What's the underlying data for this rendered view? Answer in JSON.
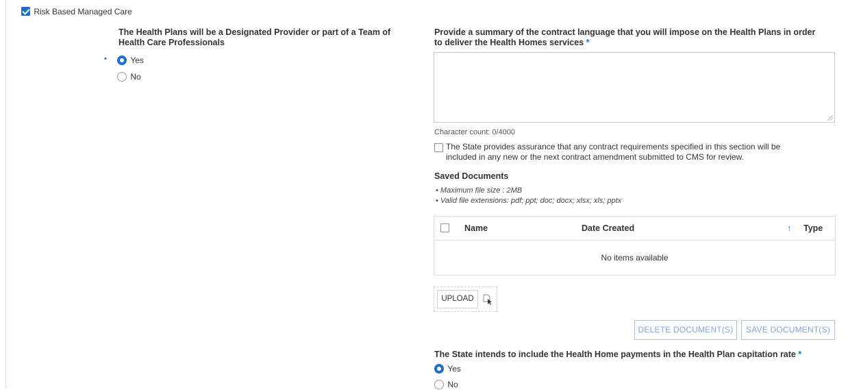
{
  "risk_checkbox": {
    "label": "Risk Based Managed Care",
    "checked": true
  },
  "left_question": {
    "label_line1": "The Health Plans will be a Designated Provider or part of a Team of",
    "label_line2": "Health Care Professionals",
    "required_marker": "•",
    "options": [
      {
        "label": "Yes",
        "selected": true
      },
      {
        "label": "No",
        "selected": false
      }
    ]
  },
  "summary": {
    "label_line1": "Provide a summary of the contract language that you will impose on the Health Plans in order",
    "label_line2": "to deliver the Health Homes services",
    "required_marker": "*",
    "value": "",
    "character_count": "Character count: 0/4000"
  },
  "assurance": {
    "line1": "The State provides assurance that any contract requirements specified in this section will be",
    "line2": "included in any new or the next contract amendment submitted to CMS for review.",
    "checked": false
  },
  "saved_documents": {
    "title": "Saved Documents",
    "notes": [
      "Maximum file size : 2MB",
      "Valid file extensions: pdf; ppt; doc; docx; xlsx; xls; pptx"
    ],
    "columns": {
      "name": "Name",
      "date_created": "Date Created",
      "type": "Type",
      "sort_indicator": "↑"
    },
    "empty_text": "No items available",
    "upload_label": "UPLOAD",
    "delete_label": "DELETE DOCUMENT(S)",
    "save_label": "SAVE DOCUMENT(S)"
  },
  "capitation_question": {
    "label": "The State intends to include the Health Home payments in the Health Plan capitation rate",
    "required_marker": "*",
    "options": [
      {
        "label": "Yes",
        "selected": true
      },
      {
        "label": "No",
        "selected": false
      }
    ]
  },
  "colors": {
    "accent": "#1f6fc6",
    "button_text_disabled": "#7fa6d6",
    "border": "#dcdcdc"
  }
}
